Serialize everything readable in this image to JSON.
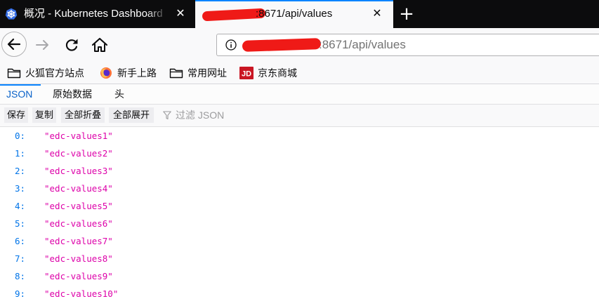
{
  "browser": {
    "tabs": [
      {
        "title": "概况 - Kubernetes Dashboard",
        "active": false,
        "icon": "kubernetes-icon"
      },
      {
        "title": ":8671/api/values",
        "active": true,
        "icon": "redacted"
      }
    ],
    "close_glyph": "✕",
    "new_tab_glyph": "+",
    "url": ":8671/api/values",
    "bookmarks": [
      {
        "label": "火狐官方站点",
        "icon": "folder-icon"
      },
      {
        "label": "新手上路",
        "icon": "firefox-icon"
      },
      {
        "label": "常用网址",
        "icon": "folder-icon"
      },
      {
        "label": "京东商城",
        "icon": "jd-icon",
        "icon_text": "JD"
      }
    ]
  },
  "json_viewer": {
    "tabs": [
      "JSON",
      "原始数据",
      "头"
    ],
    "active_tab": "JSON",
    "toolbar": {
      "save": "保存",
      "copy": "复制",
      "collapse_all": "全部折叠",
      "expand_all": "全部展开",
      "filter_placeholder": "过滤 JSON"
    },
    "rows": [
      {
        "key": "0:",
        "value": "\"edc-values1\""
      },
      {
        "key": "1:",
        "value": "\"edc-values2\""
      },
      {
        "key": "2:",
        "value": "\"edc-values3\""
      },
      {
        "key": "3:",
        "value": "\"edc-values4\""
      },
      {
        "key": "4:",
        "value": "\"edc-values5\""
      },
      {
        "key": "5:",
        "value": "\"edc-values6\""
      },
      {
        "key": "6:",
        "value": "\"edc-values7\""
      },
      {
        "key": "7:",
        "value": "\"edc-values8\""
      },
      {
        "key": "8:",
        "value": "\"edc-values9\""
      },
      {
        "key": "9:",
        "value": "\"edc-values10\""
      }
    ]
  },
  "colors": {
    "accent": "#0a84ff",
    "json_key": "#0074e8",
    "json_string": "#dd00a9",
    "redaction": "#ef1a17"
  }
}
